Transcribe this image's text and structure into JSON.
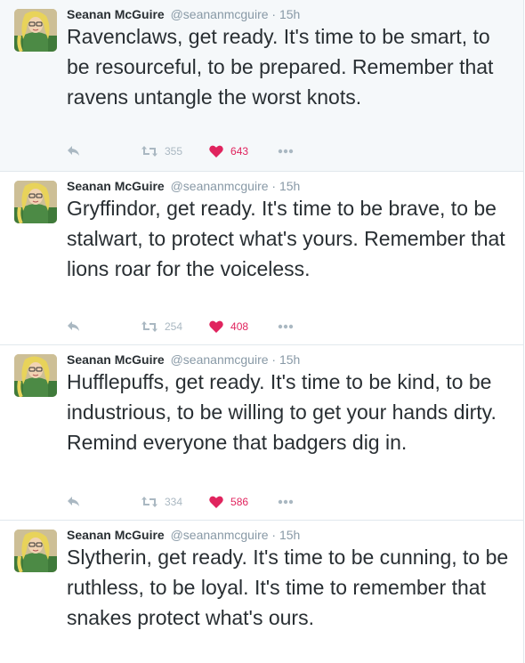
{
  "tweets": [
    {
      "author": "Seanan McGuire",
      "handle": "@seananmcguire",
      "separator": "·",
      "time": "15h",
      "text": "Ravenclaws, get ready. It's time to be smart, to be resourceful, to be prepared. Remember that ravens untangle the worst knots.",
      "retweets": "355",
      "likes": "643"
    },
    {
      "author": "Seanan McGuire",
      "handle": "@seananmcguire",
      "separator": "·",
      "time": "15h",
      "text": "Gryffindor, get ready. It's time to be brave, to be stalwart, to protect what's yours. Remember that lions roar for the voiceless.",
      "retweets": "254",
      "likes": "408"
    },
    {
      "author": "Seanan McGuire",
      "handle": "@seananmcguire",
      "separator": "·",
      "time": "15h",
      "text": "Hufflepuffs, get ready. It's time to be kind, to be industrious, to be willing to get your hands dirty. Remind everyone that badgers dig in.",
      "retweets": "334",
      "likes": "586"
    },
    {
      "author": "Seanan McGuire",
      "handle": "@seananmcguire",
      "separator": "·",
      "time": "15h",
      "text": "Slytherin, get ready. It's time to be cunning, to be ruthless, to be loyal. It's time to remember that snakes protect what's ours."
    }
  ],
  "icons": {
    "reply": "reply-icon",
    "retweet": "retweet-icon",
    "like": "heart-icon",
    "more": "more-icon"
  },
  "colors": {
    "name": "#292f33",
    "meta": "#8899a6",
    "icon": "#aab8c2",
    "like": "#e0245e",
    "divider": "#e1e8ed"
  }
}
